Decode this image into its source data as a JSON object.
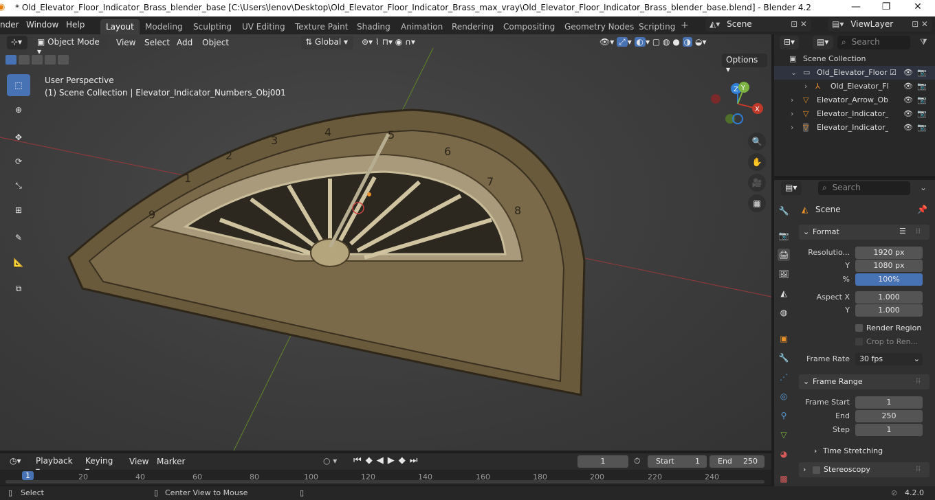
{
  "window": {
    "title": "* Old_Elevator_Floor_Indicator_Brass_blender_base [C:\\Users\\lenov\\Desktop\\Old_Elevator_Floor_Indicator_Brass_max_vray\\Old_Elevator_Floor_Indicator_Brass_blender_base.blend] - Blender 4.2",
    "minimize": "—",
    "maximize": "❐",
    "close": "✕"
  },
  "menu": {
    "items": [
      "nder",
      "Window",
      "Help"
    ]
  },
  "workspaces": [
    "Layout",
    "Modeling",
    "Sculpting",
    "UV Editing",
    "Texture Paint",
    "Shading",
    "Animation",
    "Rendering",
    "Compositing",
    "Geometry Nodes",
    "Scripting"
  ],
  "workspace_add": "+",
  "scene_selector": "Scene",
  "view_layer": "ViewLayer",
  "viewport_header": {
    "mode": "Object Mode",
    "menus": [
      "View",
      "Select",
      "Add",
      "Object"
    ],
    "orientation": "Global",
    "options": "Options"
  },
  "viewport": {
    "perspective": "User Perspective",
    "collection_info": "(1) Scene Collection | Elevator_Indicator_Numbers_Obj001",
    "gizmo": {
      "z": "Z",
      "y": "Y",
      "x": "X"
    },
    "dial_numbers": [
      "1",
      "2",
      "3",
      "4",
      "5",
      "6",
      "7",
      "8",
      "9"
    ]
  },
  "outliner": {
    "search_placeholder": "Search",
    "root": "Scene Collection",
    "rows": [
      {
        "label": "Old_Elevator_Floor",
        "indent": 0
      },
      {
        "label": "Old_Elevator_Fl",
        "indent": 1
      },
      {
        "label": "Elevator_Arrow_Ob",
        "indent": 0
      },
      {
        "label": "Elevator_Indicator_",
        "indent": 0
      },
      {
        "label": "Elevator_Indicator_",
        "indent": 0
      }
    ]
  },
  "properties": {
    "search_placeholder": "Search",
    "context": "Scene",
    "format": {
      "header": "Format",
      "resolution_x_label": "Resolutio...",
      "resolution_x": "1920 px",
      "resolution_y_label": "Y",
      "resolution_y": "1080 px",
      "percent_label": "%",
      "percent": "100%",
      "aspect_x_label": "Aspect X",
      "aspect_x": "1.000",
      "aspect_y_label": "Y",
      "aspect_y": "1.000",
      "render_region": "Render Region",
      "crop": "Crop to Ren...",
      "frame_rate_label": "Frame Rate",
      "frame_rate": "30 fps"
    },
    "frame_range": {
      "header": "Frame Range",
      "start_label": "Frame Start",
      "start": "1",
      "end_label": "End",
      "end": "250",
      "step_label": "Step",
      "step": "1"
    },
    "time_stretching": "Time Stretching",
    "stereoscopy": "Stereoscopy"
  },
  "timeline": {
    "menus": [
      "Playback",
      "Keying",
      "View",
      "Marker"
    ],
    "current_frame": "1",
    "start_label": "Start",
    "start": "1",
    "end_label": "End",
    "end": "250",
    "ticks": [
      "1",
      "20",
      "40",
      "60",
      "80",
      "100",
      "120",
      "140",
      "160",
      "180",
      "200",
      "220",
      "240"
    ]
  },
  "statusbar": {
    "select": "Select",
    "center_view": "Center View to Mouse",
    "version": "4.2.0"
  },
  "colors": {
    "accent": "#4772b3",
    "x_axis": "#c0392b",
    "y_axis": "#7cb342",
    "z_axis": "#2f7fd6"
  }
}
